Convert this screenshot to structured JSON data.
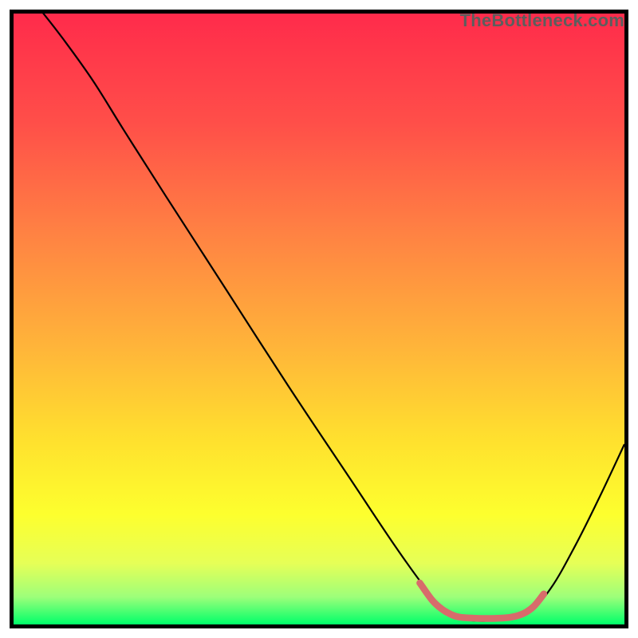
{
  "watermark": "TheBottleneck.com",
  "chart_data": {
    "type": "line",
    "title": "",
    "xlabel": "",
    "ylabel": "",
    "xlim": [
      0,
      100
    ],
    "ylim": [
      0,
      100
    ],
    "grid": false,
    "gradient_stops": [
      {
        "offset": 0.0,
        "color": "#ff2b4b"
      },
      {
        "offset": 0.18,
        "color": "#ff4f49"
      },
      {
        "offset": 0.36,
        "color": "#ff8243"
      },
      {
        "offset": 0.54,
        "color": "#ffb33a"
      },
      {
        "offset": 0.7,
        "color": "#ffe12e"
      },
      {
        "offset": 0.82,
        "color": "#fdff2e"
      },
      {
        "offset": 0.9,
        "color": "#e6ff57"
      },
      {
        "offset": 0.955,
        "color": "#9dff7a"
      },
      {
        "offset": 1.0,
        "color": "#00ff6a"
      }
    ],
    "series": [
      {
        "name": "bottleneck-curve",
        "style": {
          "stroke": "#000000",
          "width": 2.2,
          "fill": "none"
        },
        "points": [
          {
            "x": 4.5,
            "y": 100.5
          },
          {
            "x": 8.0,
            "y": 96.0
          },
          {
            "x": 13.0,
            "y": 89.0
          },
          {
            "x": 18.0,
            "y": 81.0
          },
          {
            "x": 25.0,
            "y": 70.0
          },
          {
            "x": 35.0,
            "y": 54.5
          },
          {
            "x": 45.0,
            "y": 39.0
          },
          {
            "x": 55.0,
            "y": 24.0
          },
          {
            "x": 62.0,
            "y": 13.5
          },
          {
            "x": 67.0,
            "y": 6.5
          },
          {
            "x": 70.5,
            "y": 2.5
          },
          {
            "x": 74.0,
            "y": 0.8
          },
          {
            "x": 80.0,
            "y": 0.8
          },
          {
            "x": 84.5,
            "y": 2.2
          },
          {
            "x": 88.0,
            "y": 6.0
          },
          {
            "x": 92.0,
            "y": 13.0
          },
          {
            "x": 96.0,
            "y": 21.0
          },
          {
            "x": 100.0,
            "y": 29.5
          }
        ]
      },
      {
        "name": "optimal-range-marker",
        "style": {
          "stroke": "#d86b6b",
          "width": 8.5,
          "fill": "none",
          "linecap": "round"
        },
        "points": [
          {
            "x": 66.5,
            "y": 6.8
          },
          {
            "x": 68.5,
            "y": 4.0
          },
          {
            "x": 70.0,
            "y": 2.6
          },
          {
            "x": 71.5,
            "y": 1.7
          },
          {
            "x": 73.0,
            "y": 1.2
          },
          {
            "x": 76.0,
            "y": 1.0
          },
          {
            "x": 79.0,
            "y": 1.0
          },
          {
            "x": 81.5,
            "y": 1.2
          },
          {
            "x": 83.5,
            "y": 1.8
          },
          {
            "x": 85.2,
            "y": 3.0
          },
          {
            "x": 86.8,
            "y": 5.0
          }
        ]
      }
    ]
  }
}
